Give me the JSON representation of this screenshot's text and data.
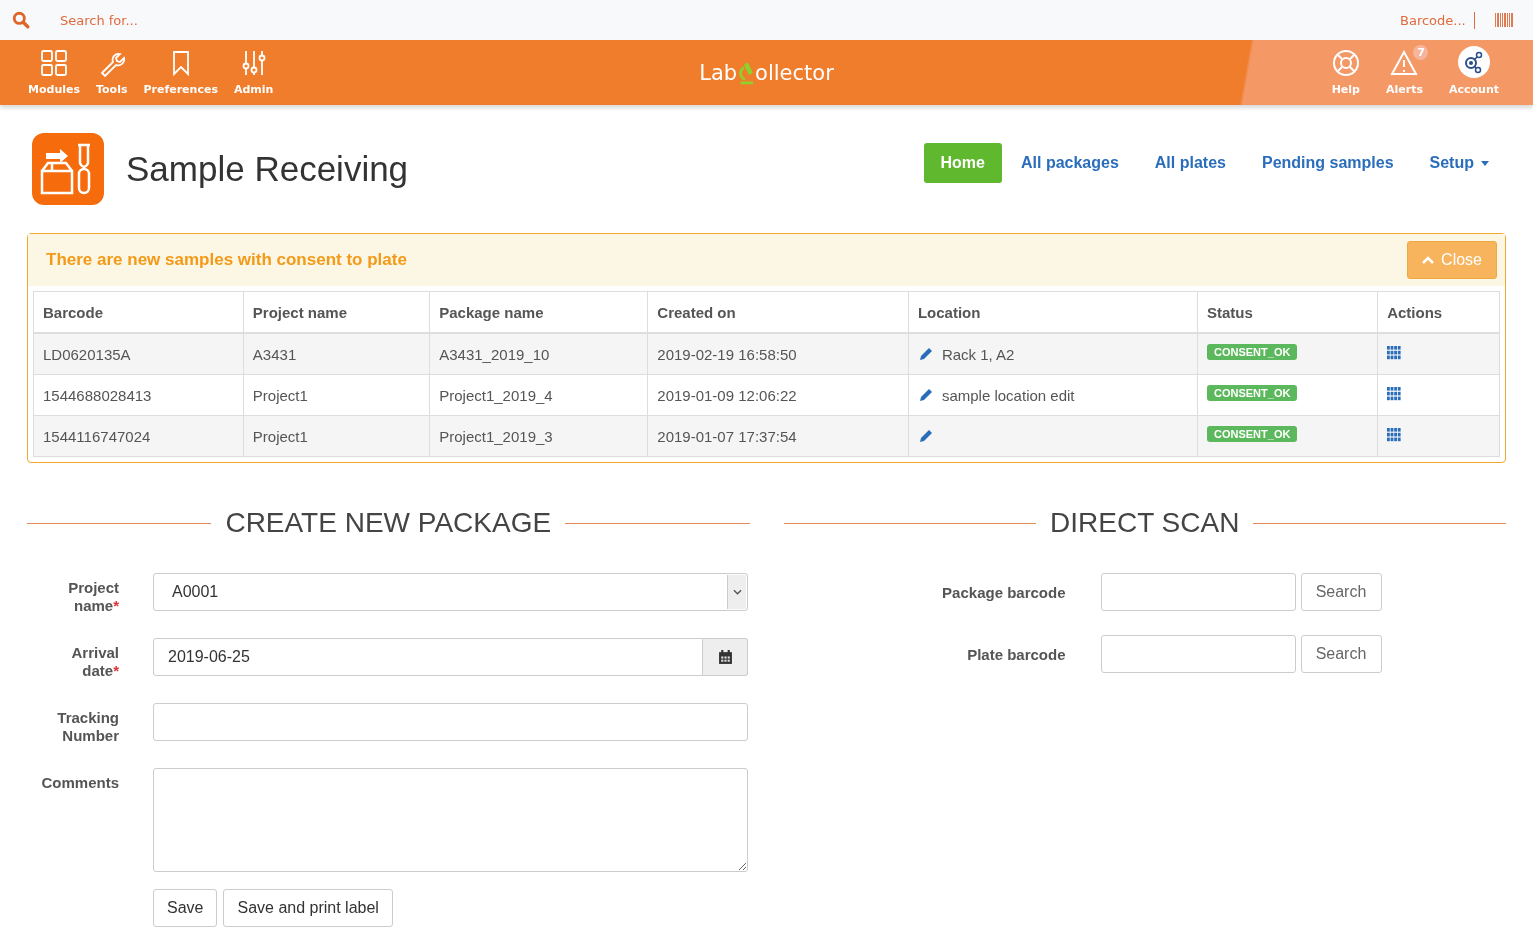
{
  "search_bar": {
    "placeholder": "Search for...",
    "barcode_placeholder": "Barcode..."
  },
  "nav_left": [
    {
      "label": "Modules"
    },
    {
      "label": "Tools"
    },
    {
      "label": "Preferences"
    },
    {
      "label": "Admin"
    }
  ],
  "logo": {
    "before": "Lab",
    "after": "ollector"
  },
  "nav_right": [
    {
      "label": "Help"
    },
    {
      "label": "Alerts",
      "badge": "7"
    },
    {
      "label": "Account"
    }
  ],
  "page_title": "Sample Receiving",
  "page_tabs": [
    {
      "label": "Home",
      "selected": true,
      "dropdown": false
    },
    {
      "label": "All packages",
      "selected": false,
      "dropdown": false
    },
    {
      "label": "All plates",
      "selected": false,
      "dropdown": false
    },
    {
      "label": "Pending samples",
      "selected": false,
      "dropdown": false
    },
    {
      "label": "Setup",
      "selected": false,
      "dropdown": true
    }
  ],
  "alert_panel": {
    "title": "There are new samples with consent to plate",
    "close_label": "Close",
    "columns": [
      "Barcode",
      "Project name",
      "Package name",
      "Created on",
      "Location",
      "Status",
      "Actions"
    ],
    "rows": [
      {
        "barcode": "LD0620135A",
        "project": "A3431",
        "package": "A3431_2019_10",
        "created": "2019-02-19 16:58:50",
        "location": "Rack 1, A2",
        "status": "CONSENT_OK"
      },
      {
        "barcode": "1544688028413",
        "project": "Project1",
        "package": "Project1_2019_4",
        "created": "2019-01-09 12:06:22",
        "location": "sample location edit",
        "status": "CONSENT_OK"
      },
      {
        "barcode": "1544116747024",
        "project": "Project1",
        "package": "Project1_2019_3",
        "created": "2019-01-07 17:37:54",
        "location": "",
        "status": "CONSENT_OK"
      }
    ]
  },
  "create_package": {
    "heading": "CREATE NEW PACKAGE",
    "fields": [
      {
        "kind": "select",
        "label_lines": [
          "Project",
          "name"
        ],
        "required_mark": "*",
        "value": "A0001"
      },
      {
        "kind": "date",
        "label_lines": [
          "Arrival",
          "date"
        ],
        "required_mark": "*",
        "value": "2019-06-25"
      },
      {
        "kind": "text",
        "label_lines": [
          "Tracking",
          "Number"
        ]
      },
      {
        "kind": "textarea",
        "label_lines": [
          "Comments"
        ]
      }
    ],
    "buttons": [
      "Save",
      "Save and print label"
    ]
  },
  "direct_scan": {
    "heading": "DIRECT SCAN",
    "fields": [
      {
        "label": "Package barcode",
        "button": "Search"
      },
      {
        "label": "Plate barcode",
        "button": "Search"
      }
    ]
  }
}
